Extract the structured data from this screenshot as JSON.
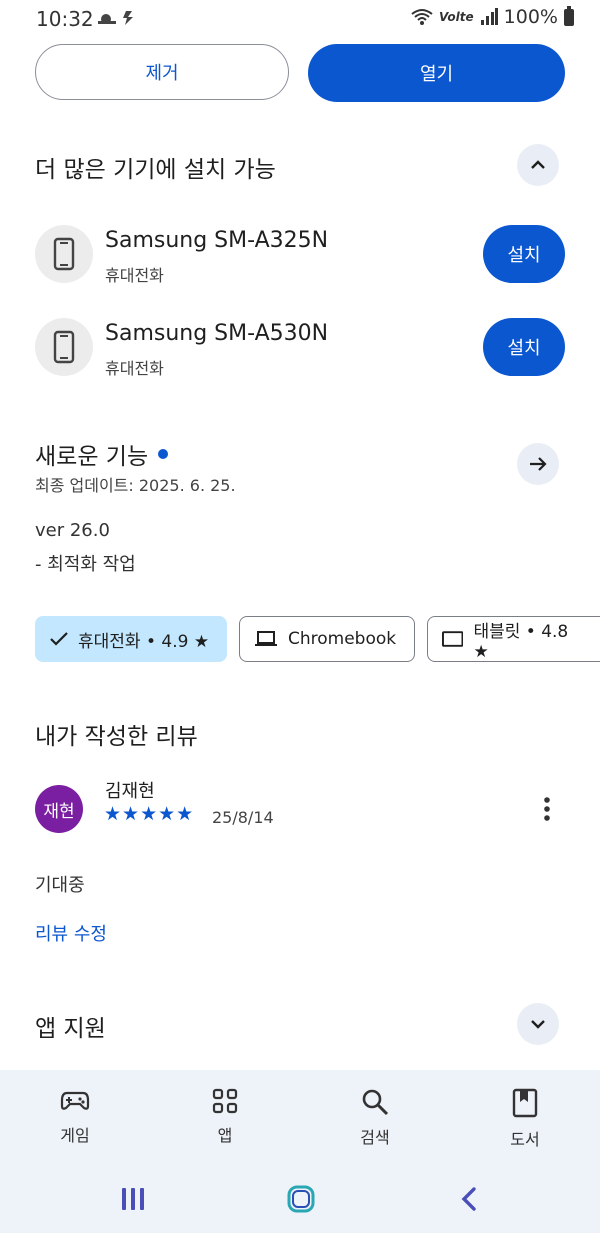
{
  "status_bar": {
    "time": "10:32",
    "battery": "100%",
    "network": "Volte"
  },
  "actions": {
    "remove_label": "제거",
    "open_label": "열기"
  },
  "devices_section": {
    "title": "더 많은 기기에 설치 가능",
    "devices": [
      {
        "name": "Samsung SM-A325N",
        "type": "휴대전화",
        "install_label": "설치"
      },
      {
        "name": "Samsung SM-A530N",
        "type": "휴대전화",
        "install_label": "설치"
      }
    ]
  },
  "whats_new": {
    "title": "새로운 기능",
    "updated": "최종 업데이트: 2025. 6. 25.",
    "version": "ver 26.0",
    "note": "- 최적화 작업"
  },
  "device_chips": [
    {
      "label": "휴대전화 • 4.9 ★",
      "selected": true
    },
    {
      "label": "Chromebook",
      "selected": false
    },
    {
      "label": "태블릿 • 4.8 ★",
      "selected": false
    }
  ],
  "my_review": {
    "title": "내가 작성한 리뷰",
    "avatar_text": "재현",
    "author": "김재현",
    "stars": "★★★★★",
    "rating": 5,
    "date": "25/8/14",
    "body": "기대중",
    "edit_label": "리뷰 수정"
  },
  "app_support": {
    "title": "앱 지원"
  },
  "bottom_nav": [
    {
      "label": "게임",
      "icon": "gamepad-icon"
    },
    {
      "label": "앱",
      "icon": "apps-grid-icon"
    },
    {
      "label": "검색",
      "icon": "search-icon"
    },
    {
      "label": "도서",
      "icon": "book-icon"
    }
  ],
  "colors": {
    "accent": "#0b57d0",
    "chip_selected": "#c2e7ff",
    "avatar": "#7b1fa2",
    "nav_background": "#eef2f9"
  }
}
